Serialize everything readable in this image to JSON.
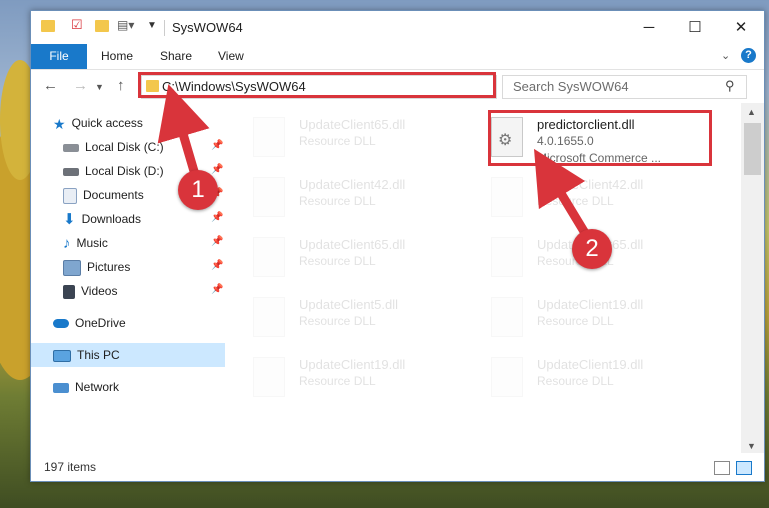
{
  "window": {
    "title": "SysWOW64",
    "ribbon_tabs": [
      "File",
      "Home",
      "Share",
      "View"
    ],
    "address": "C:\\Windows\\SysWOW64",
    "search_placeholder": "Search SysWOW64",
    "status": "197 items"
  },
  "sidebar": {
    "items": [
      {
        "label": "Quick access",
        "icon": "star-icon",
        "pinned": false
      },
      {
        "label": "Local Disk (C:)",
        "icon": "drive-icon",
        "pinned": true
      },
      {
        "label": "Local Disk (D:)",
        "icon": "drive-icon",
        "pinned": true
      },
      {
        "label": "Documents",
        "icon": "documents-icon",
        "pinned": true
      },
      {
        "label": "Downloads",
        "icon": "downloads-icon",
        "pinned": true
      },
      {
        "label": "Music",
        "icon": "music-icon",
        "pinned": true
      },
      {
        "label": "Pictures",
        "icon": "pictures-icon",
        "pinned": true
      },
      {
        "label": "Videos",
        "icon": "videos-icon",
        "pinned": true
      },
      {
        "label": "OneDrive",
        "icon": "cloud-icon",
        "pinned": false
      },
      {
        "label": "This PC",
        "icon": "computer-icon",
        "pinned": false
      },
      {
        "label": "Network",
        "icon": "network-icon",
        "pinned": false
      }
    ]
  },
  "files": [
    {
      "name": "UpdateClient65.dll",
      "sub": "Resource DLL",
      "extra": ""
    },
    {
      "name": "predictorclient.dll",
      "sub": "4.0.1655.0",
      "extra": "Microsoft Commerce ..."
    },
    {
      "name": "UpdateClient42.dll",
      "sub": "Resource DLL",
      "extra": ""
    },
    {
      "name": "UpdateClient42.dll",
      "sub": "Resource DLL",
      "extra": ""
    },
    {
      "name": "UpdateClient65.dll",
      "sub": "Resource DLL",
      "extra": ""
    },
    {
      "name": "UpdateClient65.dll",
      "sub": "Resource DLL",
      "extra": ""
    },
    {
      "name": "UpdateClient5.dll",
      "sub": "Resource DLL",
      "extra": ""
    },
    {
      "name": "UpdateClient19.dll",
      "sub": "Resource DLL",
      "extra": ""
    },
    {
      "name": "UpdateClient19.dll",
      "sub": "Resource DLL",
      "extra": ""
    },
    {
      "name": "UpdateClient19.dll",
      "sub": "Resource DLL",
      "extra": ""
    }
  ],
  "annotations": [
    "1",
    "2"
  ],
  "colors": {
    "accent": "#1979ca",
    "highlight": "#d9343b",
    "selection": "#cce8ff"
  }
}
